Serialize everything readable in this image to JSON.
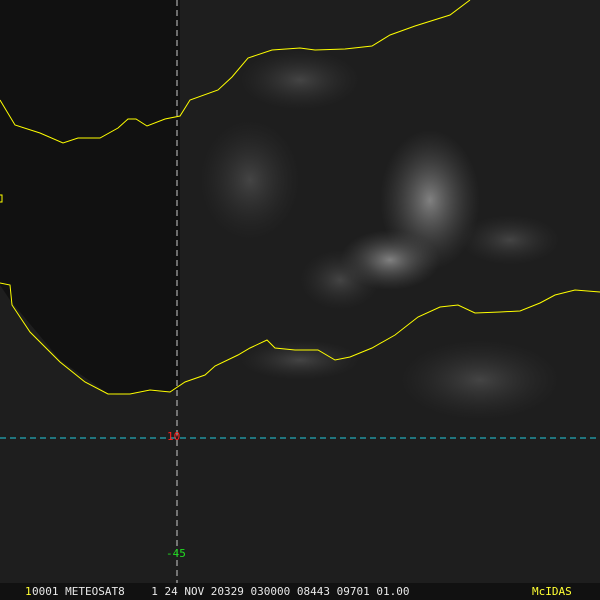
{
  "image": {
    "frame_number": "1",
    "footer": "0001 METEOSAT8    1 24 NOV 20329 030000 08443 09701 01.00",
    "brand": "McIDAS"
  },
  "grid": {
    "latitude_label": "10",
    "longitude_label": "-45",
    "line_color": "#22ccdd"
  },
  "colors": {
    "coastline": "#ffff00",
    "lat_label": "#ff2020",
    "lon_label": "#22dd22",
    "brand": "#ffff33"
  }
}
